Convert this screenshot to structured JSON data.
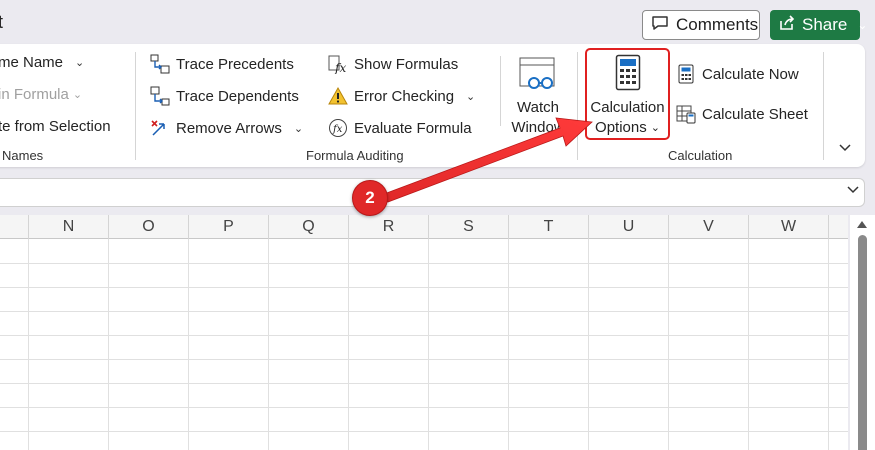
{
  "titlebar": {
    "title_fragment": "t",
    "comments_label": "Comments",
    "share_label": "Share"
  },
  "ribbon": {
    "defined_names": {
      "define_name": "me Name",
      "use_in_formula": "in Formula",
      "create_from_selection": "te from Selection",
      "group_label": "Names"
    },
    "formula_auditing": {
      "trace_precedents": "Trace Precedents",
      "trace_dependents": "Trace Dependents",
      "remove_arrows": "Remove Arrows",
      "show_formulas": "Show Formulas",
      "error_checking": "Error Checking",
      "evaluate_formula": "Evaluate Formula",
      "watch_window_line1": "Watch",
      "watch_window_line2": "Window",
      "group_label": "Formula Auditing"
    },
    "calculation": {
      "calc_options_line1": "Calculation",
      "calc_options_line2": "Options",
      "calculate_now": "Calculate Now",
      "calculate_sheet": "Calculate Sheet",
      "group_label": "Calculation"
    }
  },
  "grid": {
    "columns": [
      "N",
      "O",
      "P",
      "Q",
      "R",
      "S",
      "T",
      "U",
      "V",
      "W"
    ]
  },
  "annotation": {
    "step_number": "2",
    "color": "#e02828"
  },
  "colors": {
    "share_green": "#1e7a44",
    "highlight_red": "#e02020",
    "background": "#ebeaf0"
  }
}
